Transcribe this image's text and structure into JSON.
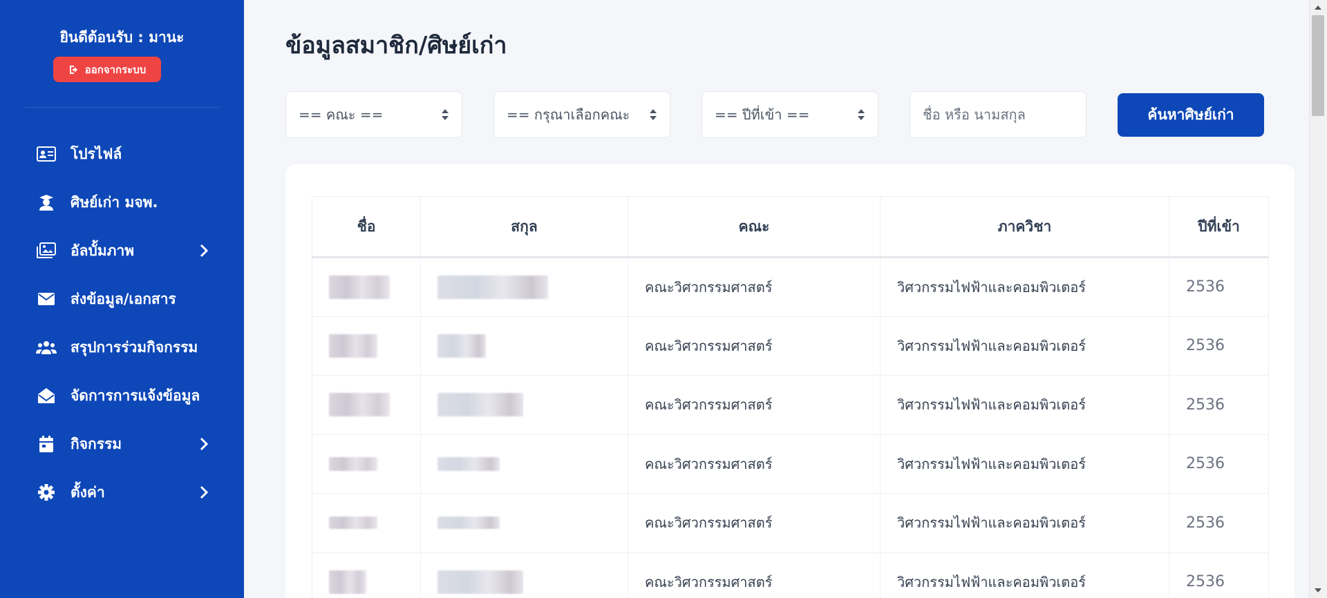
{
  "sidebar": {
    "welcome": "ยินดีต้อนรับ : มานะ",
    "logout_label": "ออกจากระบบ",
    "items": [
      {
        "label": "โปรไฟล์",
        "icon": "id-card-icon",
        "has_submenu": false
      },
      {
        "label": "ศิษย์เก่า มจพ.",
        "icon": "graduate-icon",
        "has_submenu": false
      },
      {
        "label": "อัลบั้มภาพ",
        "icon": "images-icon",
        "has_submenu": true
      },
      {
        "label": "ส่งข้อมูล/เอกสาร",
        "icon": "envelope-icon",
        "has_submenu": false
      },
      {
        "label": "สรุปการร่วมกิจกรรม",
        "icon": "users-icon",
        "has_submenu": false
      },
      {
        "label": "จัดการการแจ้งข้อมูล",
        "icon": "envelope-open-icon",
        "has_submenu": false
      },
      {
        "label": "กิจกรรม",
        "icon": "calendar-icon",
        "has_submenu": true
      },
      {
        "label": "ตั้งค่า",
        "icon": "gear-icon",
        "has_submenu": true
      }
    ]
  },
  "main": {
    "title": "ข้อมูลสมาชิก/ศิษย์เก่า",
    "filters": {
      "faculty": "== คณะ ==",
      "department": "== กรุณาเลือกคณะ",
      "year": "== ปีที่เข้า ==",
      "name_placeholder": "ชื่อ หรือ นามสกุล"
    },
    "search_label": "ค้นหาศิษย์เก่า"
  },
  "table": {
    "headers": [
      "ชื่อ",
      "สกุล",
      "คณะ",
      "ภาควิชา",
      "ปีที่เข้า"
    ],
    "rows": [
      {
        "faculty": "คณะวิศวกรรมศาสตร์",
        "department": "วิศวกรรมไฟฟ้าและคอมพิวเตอร์",
        "year": "2536"
      },
      {
        "faculty": "คณะวิศวกรรมศาสตร์",
        "department": "วิศวกรรมไฟฟ้าและคอมพิวเตอร์",
        "year": "2536"
      },
      {
        "faculty": "คณะวิศวกรรมศาสตร์",
        "department": "วิศวกรรมไฟฟ้าและคอมพิวเตอร์",
        "year": "2536"
      },
      {
        "faculty": "คณะวิศวกรรมศาสตร์",
        "department": "วิศวกรรมไฟฟ้าและคอมพิวเตอร์",
        "year": "2536"
      },
      {
        "faculty": "คณะวิศวกรรมศาสตร์",
        "department": "วิศวกรรมไฟฟ้าและคอมพิวเตอร์",
        "year": "2536"
      },
      {
        "faculty": "คณะวิศวกรรมศาสตร์",
        "department": "วิศวกรรมไฟฟ้าและคอมพิวเตอร์",
        "year": "2536"
      }
    ]
  },
  "colors": {
    "sidebar": "#0d47b8",
    "logout": "#ef4444",
    "primary_button": "#0d47b8"
  }
}
